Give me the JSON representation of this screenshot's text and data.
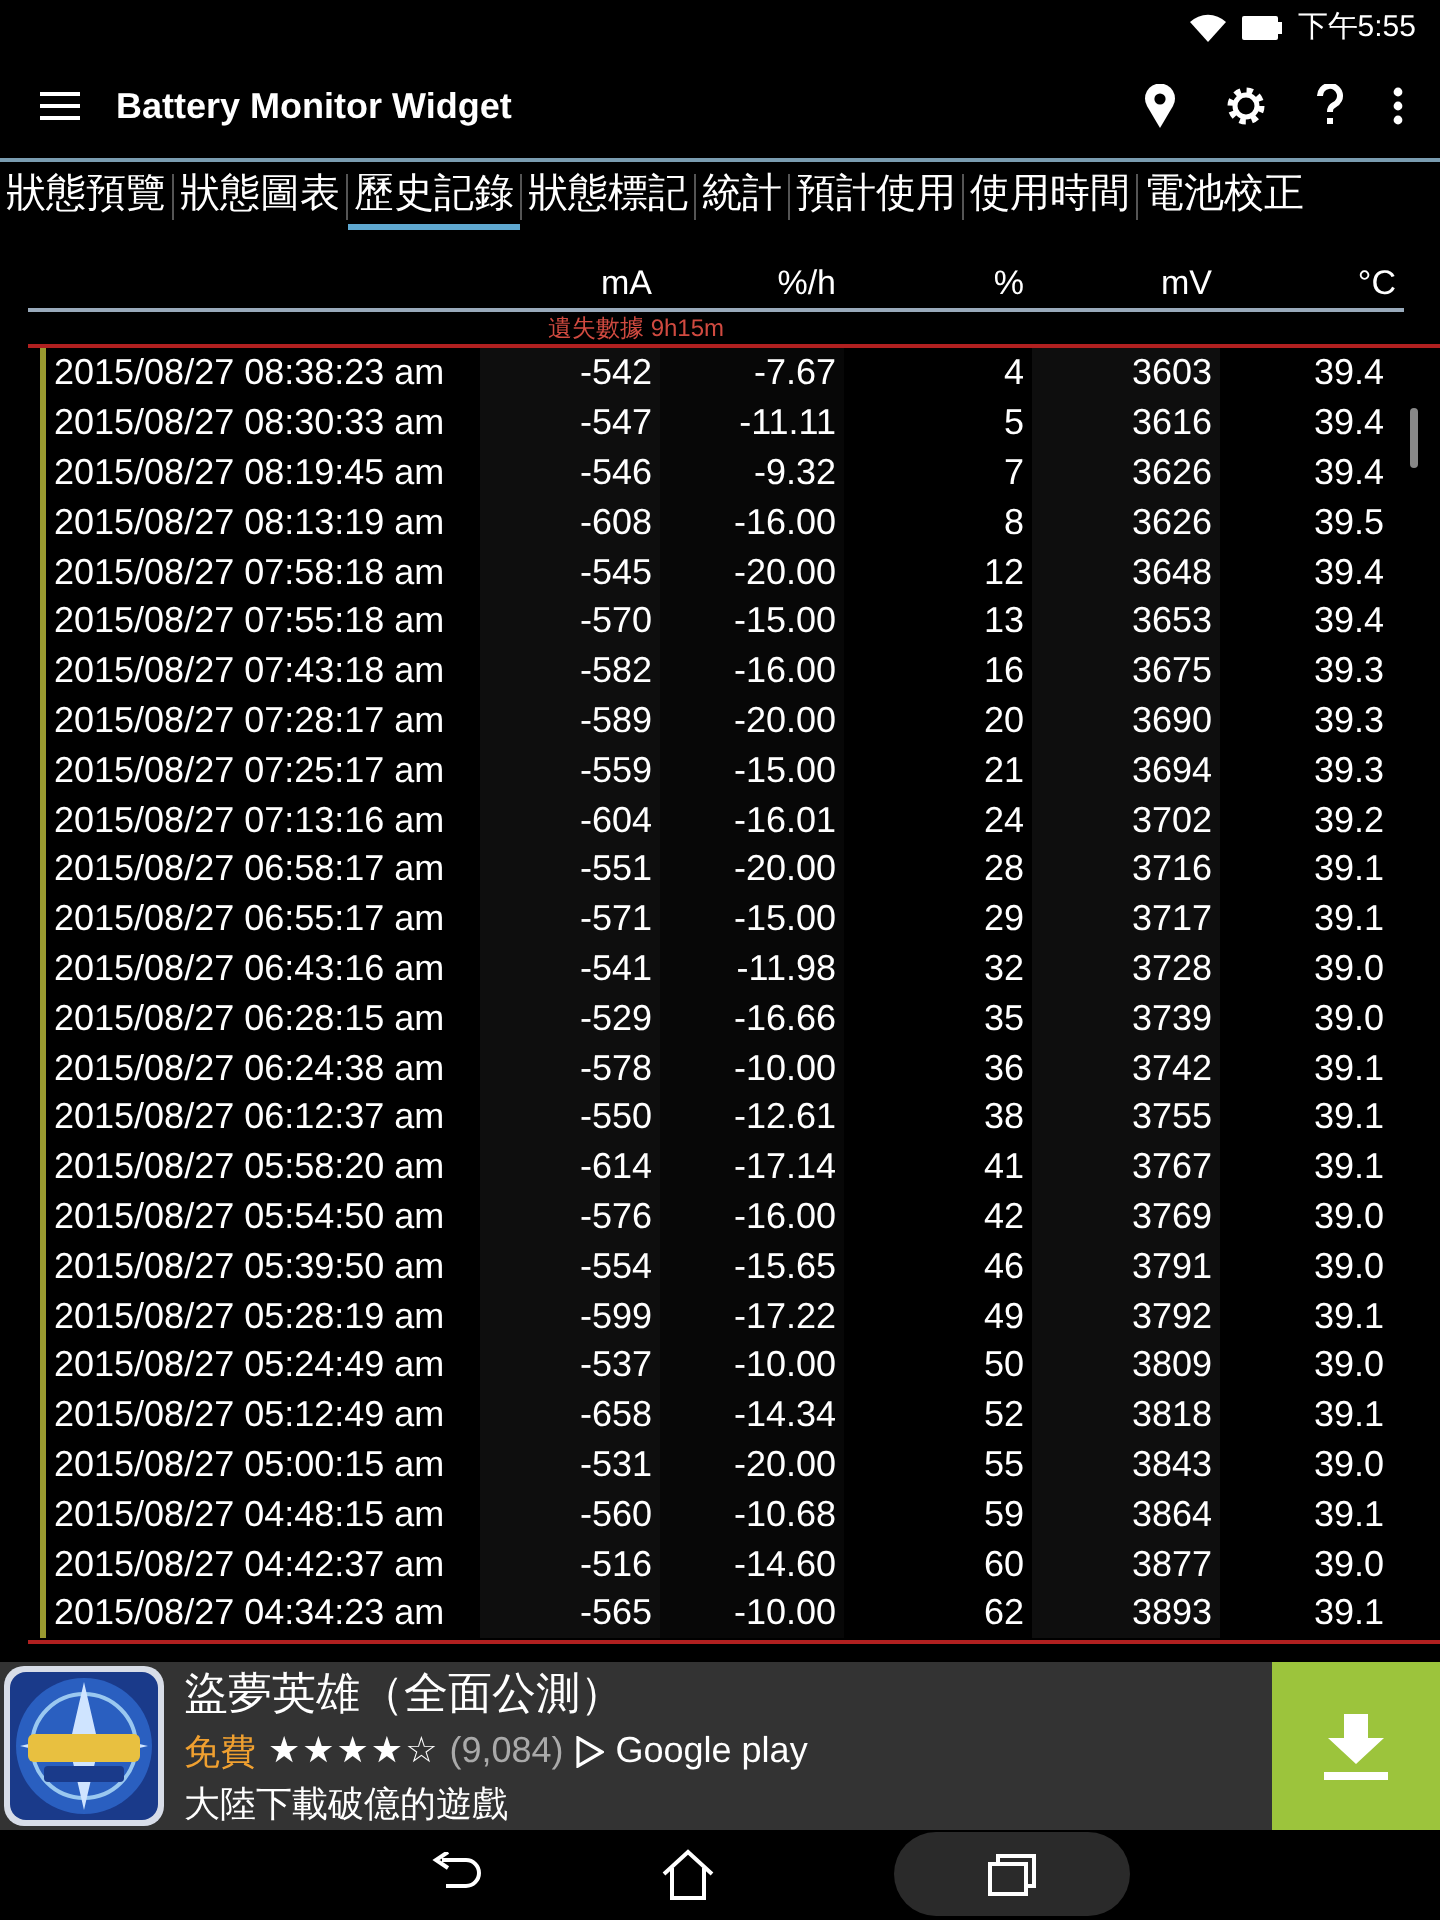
{
  "status_bar": {
    "time": "下午5:55"
  },
  "app_bar": {
    "title": "Battery Monitor Widget"
  },
  "tabs": [
    {
      "label": "狀態預覽",
      "selected": false
    },
    {
      "label": "狀態圖表",
      "selected": false
    },
    {
      "label": "歷史記錄",
      "selected": true
    },
    {
      "label": "狀態標記",
      "selected": false
    },
    {
      "label": "統計",
      "selected": false
    },
    {
      "label": "預計使用",
      "selected": false
    },
    {
      "label": "使用時間",
      "selected": false
    },
    {
      "label": "電池校正",
      "selected": false
    }
  ],
  "table": {
    "columns": [
      "",
      "mA",
      "%/h",
      "%",
      "mV",
      "°C"
    ],
    "gap_note": "遺失數據 9h15m",
    "rows": [
      [
        "2015/08/27 08:38:23 am",
        "-542",
        "-7.67",
        "4",
        "3603",
        "39.4"
      ],
      [
        "2015/08/27 08:30:33 am",
        "-547",
        "-11.11",
        "5",
        "3616",
        "39.4"
      ],
      [
        "2015/08/27 08:19:45 am",
        "-546",
        "-9.32",
        "7",
        "3626",
        "39.4"
      ],
      [
        "2015/08/27 08:13:19 am",
        "-608",
        "-16.00",
        "8",
        "3626",
        "39.5"
      ],
      [
        "2015/08/27 07:58:18 am",
        "-545",
        "-20.00",
        "12",
        "3648",
        "39.4"
      ],
      [
        "2015/08/27 07:55:18 am",
        "-570",
        "-15.00",
        "13",
        "3653",
        "39.4"
      ],
      [
        "2015/08/27 07:43:18 am",
        "-582",
        "-16.00",
        "16",
        "3675",
        "39.3"
      ],
      [
        "2015/08/27 07:28:17 am",
        "-589",
        "-20.00",
        "20",
        "3690",
        "39.3"
      ],
      [
        "2015/08/27 07:25:17 am",
        "-559",
        "-15.00",
        "21",
        "3694",
        "39.3"
      ],
      [
        "2015/08/27 07:13:16 am",
        "-604",
        "-16.01",
        "24",
        "3702",
        "39.2"
      ],
      [
        "2015/08/27 06:58:17 am",
        "-551",
        "-20.00",
        "28",
        "3716",
        "39.1"
      ],
      [
        "2015/08/27 06:55:17 am",
        "-571",
        "-15.00",
        "29",
        "3717",
        "39.1"
      ],
      [
        "2015/08/27 06:43:16 am",
        "-541",
        "-11.98",
        "32",
        "3728",
        "39.0"
      ],
      [
        "2015/08/27 06:28:15 am",
        "-529",
        "-16.66",
        "35",
        "3739",
        "39.0"
      ],
      [
        "2015/08/27 06:24:38 am",
        "-578",
        "-10.00",
        "36",
        "3742",
        "39.1"
      ],
      [
        "2015/08/27 06:12:37 am",
        "-550",
        "-12.61",
        "38",
        "3755",
        "39.1"
      ],
      [
        "2015/08/27 05:58:20 am",
        "-614",
        "-17.14",
        "41",
        "3767",
        "39.1"
      ],
      [
        "2015/08/27 05:54:50 am",
        "-576",
        "-16.00",
        "42",
        "3769",
        "39.0"
      ],
      [
        "2015/08/27 05:39:50 am",
        "-554",
        "-15.65",
        "46",
        "3791",
        "39.0"
      ],
      [
        "2015/08/27 05:28:19 am",
        "-599",
        "-17.22",
        "49",
        "3792",
        "39.1"
      ],
      [
        "2015/08/27 05:24:49 am",
        "-537",
        "-10.00",
        "50",
        "3809",
        "39.0"
      ],
      [
        "2015/08/27 05:12:49 am",
        "-658",
        "-14.34",
        "52",
        "3818",
        "39.1"
      ],
      [
        "2015/08/27 05:00:15 am",
        "-531",
        "-20.00",
        "55",
        "3843",
        "39.0"
      ],
      [
        "2015/08/27 04:48:15 am",
        "-560",
        "-10.68",
        "59",
        "3864",
        "39.1"
      ],
      [
        "2015/08/27 04:42:37 am",
        "-516",
        "-14.60",
        "60",
        "3877",
        "39.0"
      ],
      [
        "2015/08/27 04:34:23 am",
        "-565",
        "-10.00",
        "62",
        "3893",
        "39.1"
      ]
    ]
  },
  "ad": {
    "title": "盜夢英雄（全面公測）",
    "price": "免費",
    "stars": 4,
    "rating_count": "(9,084)",
    "store": "Google play",
    "tagline": "大陸下載破億的遊戲"
  }
}
